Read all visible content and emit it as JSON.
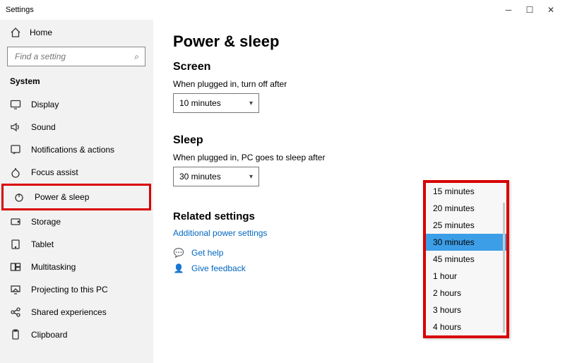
{
  "window": {
    "title": "Settings"
  },
  "sidebar": {
    "home": "Home",
    "search_placeholder": "Find a setting",
    "group": "System",
    "items": [
      {
        "label": "Display"
      },
      {
        "label": "Sound"
      },
      {
        "label": "Notifications & actions"
      },
      {
        "label": "Focus assist"
      },
      {
        "label": "Power & sleep"
      },
      {
        "label": "Storage"
      },
      {
        "label": "Tablet"
      },
      {
        "label": "Multitasking"
      },
      {
        "label": "Projecting to this PC"
      },
      {
        "label": "Shared experiences"
      },
      {
        "label": "Clipboard"
      }
    ]
  },
  "page": {
    "title": "Power & sleep",
    "screen": {
      "heading": "Screen",
      "label": "When plugged in, turn off after",
      "value": "10 minutes"
    },
    "sleep": {
      "heading": "Sleep",
      "label": "When plugged in, PC goes to sleep after",
      "value": "30 minutes"
    },
    "related": {
      "heading": "Related settings",
      "additional": "Additional power settings"
    },
    "help": {
      "get": "Get help",
      "feedback": "Give feedback"
    },
    "dropdown": {
      "options": [
        "15 minutes",
        "20 minutes",
        "25 minutes",
        "30 minutes",
        "45 minutes",
        "1 hour",
        "2 hours",
        "3 hours",
        "4 hours"
      ],
      "selected": "30 minutes"
    }
  }
}
